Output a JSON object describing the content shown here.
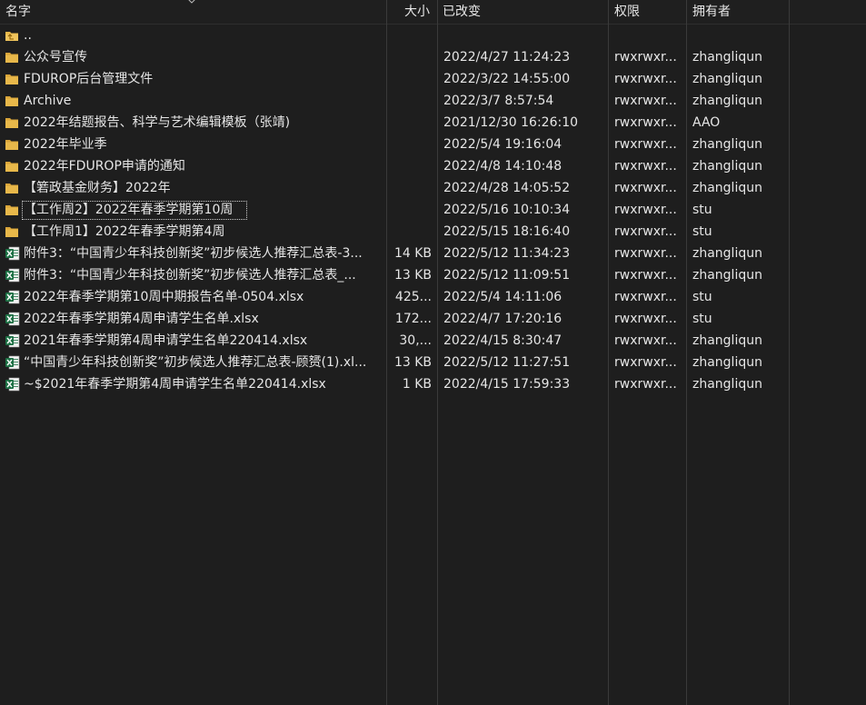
{
  "header": {
    "name": "名字",
    "size": "大小",
    "modified": "已改变",
    "permissions": "权限",
    "owner": "拥有者"
  },
  "rows": [
    {
      "icon": "parent-folder-icon",
      "name": "..",
      "size": "",
      "date": "",
      "perm": "",
      "owner": ""
    },
    {
      "icon": "folder-icon",
      "name": "公众号宣传",
      "size": "",
      "date": "2022/4/27 11:24:23",
      "perm": "rwxrwxr...",
      "owner": "zhangliqun"
    },
    {
      "icon": "folder-icon",
      "name": "FDUROP后台管理文件",
      "size": "",
      "date": "2022/3/22 14:55:00",
      "perm": "rwxrwxr...",
      "owner": "zhangliqun"
    },
    {
      "icon": "folder-icon",
      "name": "Archive",
      "size": "",
      "date": "2022/3/7 8:57:54",
      "perm": "rwxrwxr...",
      "owner": "zhangliqun"
    },
    {
      "icon": "folder-icon",
      "name": "2022年结题报告、科学与艺术编辑模板（张靖)",
      "size": "",
      "date": "2021/12/30 16:26:10",
      "perm": "rwxrwxr...",
      "owner": "AAO"
    },
    {
      "icon": "folder-icon",
      "name": "2022年毕业季",
      "size": "",
      "date": "2022/5/4 19:16:04",
      "perm": "rwxrwxr...",
      "owner": "zhangliqun"
    },
    {
      "icon": "folder-icon",
      "name": "2022年FDUROP申请的通知",
      "size": "",
      "date": "2022/4/8 14:10:48",
      "perm": "rwxrwxr...",
      "owner": "zhangliqun"
    },
    {
      "icon": "folder-icon",
      "name": "【箬政基金财务】2022年",
      "size": "",
      "date": "2022/4/28 14:05:52",
      "perm": "rwxrwxr...",
      "owner": "zhangliqun"
    },
    {
      "icon": "folder-icon",
      "name": "【工作周2】2022年春季学期第10周",
      "size": "",
      "date": "2022/5/16 10:10:34",
      "perm": "rwxrwxr...",
      "owner": "stu",
      "focused": true
    },
    {
      "icon": "folder-icon",
      "name": "【工作周1】2022年春季学期第4周",
      "size": "",
      "date": "2022/5/15 18:16:40",
      "perm": "rwxrwxr...",
      "owner": "stu"
    },
    {
      "icon": "excel-file-icon",
      "name": "附件3：“中国青少年科技创新奖”初步候选人推荐汇总表-3...",
      "size": "14 KB",
      "date": "2022/5/12 11:34:23",
      "perm": "rwxrwxr...",
      "owner": "zhangliqun"
    },
    {
      "icon": "excel-file-icon",
      "name": "附件3：“中国青少年科技创新奖”初步候选人推荐汇总表_...",
      "size": "13 KB",
      "date": "2022/5/12 11:09:51",
      "perm": "rwxrwxr...",
      "owner": "zhangliqun"
    },
    {
      "icon": "excel-file-icon",
      "name": "2022年春季学期第10周中期报告名单-0504.xlsx",
      "size": "425...",
      "date": "2022/5/4 14:11:06",
      "perm": "rwxrwxr...",
      "owner": "stu"
    },
    {
      "icon": "excel-file-icon",
      "name": "2022年春季学期第4周申请学生名单.xlsx",
      "size": "172...",
      "date": "2022/4/7 17:20:16",
      "perm": "rwxrwxr...",
      "owner": "stu"
    },
    {
      "icon": "excel-file-icon",
      "name": "2021年春季学期第4周申请学生名单220414.xlsx",
      "size": "30,...",
      "date": "2022/4/15 8:30:47",
      "perm": "rwxrwxr...",
      "owner": "zhangliqun"
    },
    {
      "icon": "excel-file-icon",
      "name": "“中国青少年科技创新奖”初步候选人推荐汇总表-顾赟(1).xl...",
      "size": "13 KB",
      "date": "2022/5/12 11:27:51",
      "perm": "rwxrwxr...",
      "owner": "zhangliqun"
    },
    {
      "icon": "excel-file-icon",
      "name": "~$2021年春季学期第4周申请学生名单220414.xlsx",
      "size": "1 KB",
      "date": "2022/4/15 17:59:33",
      "perm": "rwxrwxr...",
      "owner": "zhangliqun"
    }
  ],
  "colors": {
    "background": "#1e1e1e",
    "text": "#e6e6e6",
    "folder": "#e8b84a",
    "excel": "#1d7044"
  }
}
